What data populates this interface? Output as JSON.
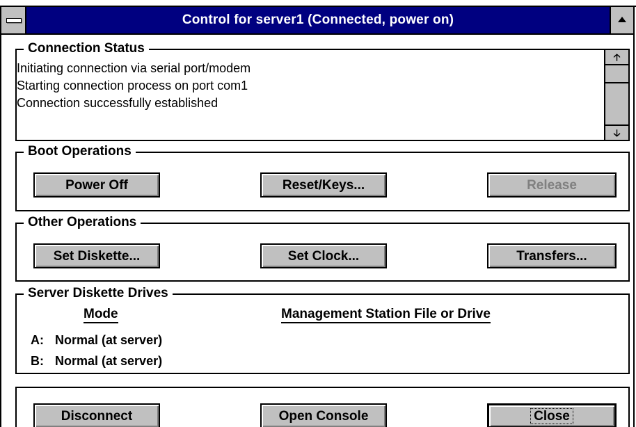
{
  "window": {
    "title": "Control for server1 (Connected, power on)",
    "titlebar_color": "#000080",
    "face_color": "#c0c0c0"
  },
  "connection_status": {
    "label": "Connection Status",
    "lines": [
      "Initiating connection via serial port/modem",
      "Starting connection process on port com1",
      "Connection successfully established"
    ]
  },
  "boot_operations": {
    "label": "Boot Operations",
    "power_off": "Power Off",
    "reset_keys": "Reset/Keys...",
    "release": "Release"
  },
  "other_operations": {
    "label": "Other Operations",
    "set_diskette": "Set Diskette...",
    "set_clock": "Set Clock...",
    "transfers": "Transfers..."
  },
  "diskette_drives": {
    "label": "Server Diskette Drives",
    "mode_header": "Mode",
    "file_header": "Management Station File or Drive",
    "drives": [
      {
        "letter": "A:",
        "mode": "Normal (at server)"
      },
      {
        "letter": "B:",
        "mode": "Normal (at server)"
      }
    ]
  },
  "footer": {
    "disconnect": "Disconnect",
    "open_console": "Open Console",
    "close": "Close"
  },
  "icons": {
    "system_menu": "system-menu-icon",
    "maximize": "maximize-arrow-icon",
    "scroll_up": "scroll-up-arrow-icon",
    "scroll_down": "scroll-down-arrow-icon"
  }
}
